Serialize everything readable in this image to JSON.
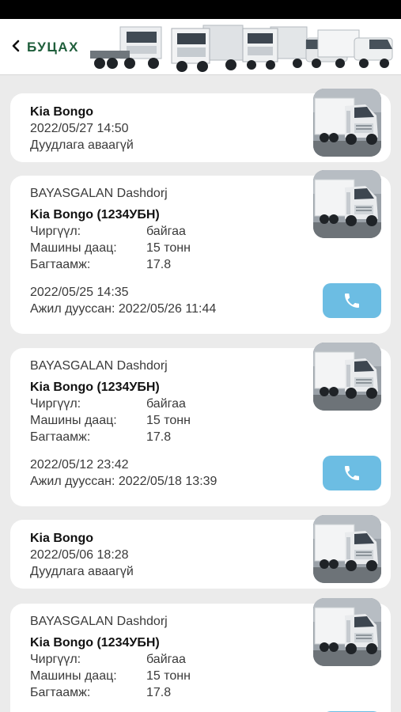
{
  "header": {
    "back_label": "БУЦАХ",
    "back_icon": "chevron-left-icon",
    "banner": "trucks-banner-image"
  },
  "colors": {
    "accent_green": "#1f5e3b",
    "call_button": "#6cbde3",
    "card_bg": "#ffffff",
    "page_bg": "#ebebeb"
  },
  "orders": [
    {
      "vehicle": "Kia Bongo",
      "datetime": "2022/05/27 14:50",
      "status": "Дуудлага аваагүй"
    },
    {
      "driver": "BAYASGALAN Dashdorj",
      "vehicle": "Kia Bongo (1234УБН)",
      "trailer_label": "Чиргүүл:",
      "trailer_value": "байгаа",
      "capacity_label": "Машины даац:",
      "capacity_value": "15 тонн",
      "volume_label": "Багтаамж:",
      "volume_value": "17.8",
      "datetime": "2022/05/25 14:35",
      "finished": "Ажил дууссан: 2022/05/26 11:44"
    },
    {
      "driver": "BAYASGALAN Dashdorj",
      "vehicle": "Kia Bongo (1234УБН)",
      "trailer_label": "Чиргүүл:",
      "trailer_value": "байгаа",
      "capacity_label": "Машины даац:",
      "capacity_value": "15 тонн",
      "volume_label": "Багтаамж:",
      "volume_value": "17.8",
      "datetime": "2022/05/12 23:42",
      "finished": "Ажил дууссан: 2022/05/18 13:39"
    },
    {
      "vehicle": "Kia Bongo",
      "datetime": "2022/05/06 18:28",
      "status": "Дуудлага аваагүй"
    },
    {
      "driver": "BAYASGALAN Dashdorj",
      "vehicle": "Kia Bongo (1234УБН)",
      "trailer_label": "Чиргүүл:",
      "trailer_value": "байгаа",
      "capacity_label": "Машины даац:",
      "capacity_value": "15 тонн",
      "volume_label": "Багтаамж:",
      "volume_value": "17.8"
    }
  ]
}
